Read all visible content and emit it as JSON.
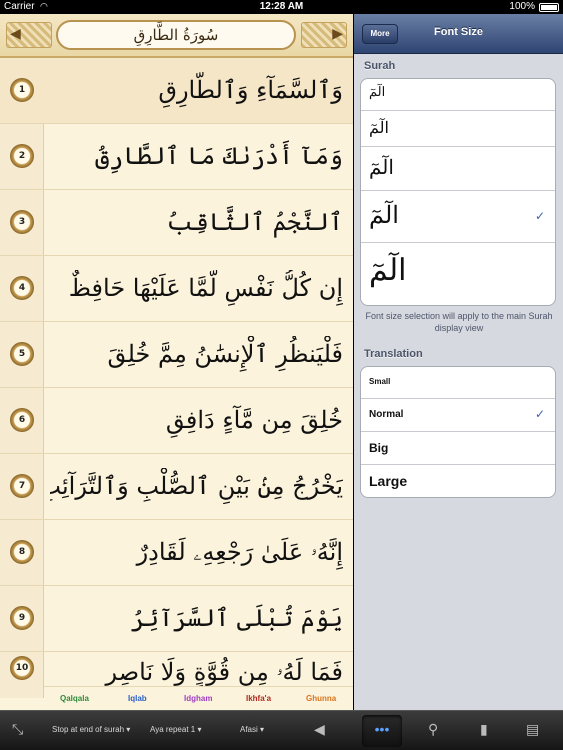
{
  "status_bar": {
    "carrier": "Carrier",
    "time": "12:28 AM",
    "battery": "100%"
  },
  "surah_header": {
    "title": "سُورَةُ الطَّارِقِ"
  },
  "ayat": [
    {
      "number": "1",
      "text": "وَٱلسَّمَآءِ وَٱلطَّارِقِ"
    },
    {
      "number": "2",
      "text": "وَمَآ أَدْرَىٰكَ مَا ٱلطَّارِقُ"
    },
    {
      "number": "3",
      "text": "ٱلنَّجْمُ ٱلثَّاقِبُ"
    },
    {
      "number": "4",
      "text": "إِن كُلُّ نَفْسٍ لَّمَّا عَلَيْهَا حَافِظٌ"
    },
    {
      "number": "5",
      "text": "فَلْيَنظُرِ ٱلْإِنسَٰنُ مِمَّ خُلِقَ"
    },
    {
      "number": "6",
      "text": "خُلِقَ مِن مَّآءٍ دَافِقٍ"
    },
    {
      "number": "7",
      "text": "يَخْرُجُ مِنۢ بَيْنِ ٱلصُّلْبِ وَٱلتَّرَآئِبِ"
    },
    {
      "number": "8",
      "text": "إِنَّهُۥ عَلَىٰ رَجْعِهِۦ لَقَادِرٌ"
    },
    {
      "number": "9",
      "text": "يَوْمَ تُبْلَى ٱلسَّرَآئِرُ"
    },
    {
      "number": "10",
      "text": "فَمَا لَهُۥ مِن قُوَّةٍ وَلَا نَاصِرٍ"
    }
  ],
  "legend": {
    "items": [
      {
        "label": "Qalqala",
        "color": "#2e8b3a"
      },
      {
        "label": "Iqlab",
        "color": "#2a5fc4"
      },
      {
        "label": "Idgham",
        "color": "#a03cc4"
      },
      {
        "label": "Ikhfa'a",
        "color": "#b0281e"
      },
      {
        "label": "Ghunna",
        "color": "#d9741c"
      }
    ]
  },
  "settings": {
    "more_label": "More",
    "title": "Font Size",
    "surah_section": "Surah",
    "surah_sizes": [
      {
        "glyph": "الٓمٓ",
        "selected": false
      },
      {
        "glyph": "الٓمٓ",
        "selected": false
      },
      {
        "glyph": "الٓمٓ",
        "selected": false
      },
      {
        "glyph": "الٓمٓ",
        "selected": true
      },
      {
        "glyph": "الٓمٓ",
        "selected": false
      }
    ],
    "note": "Font size selection will apply to the main Surah display view",
    "translation_section": "Translation",
    "translation_sizes": [
      {
        "label": "Small",
        "selected": false
      },
      {
        "label": "Normal",
        "selected": true
      },
      {
        "label": "Big",
        "selected": false
      },
      {
        "label": "Large",
        "selected": false
      }
    ],
    "check_mark": "✓"
  },
  "toolbar": {
    "stop_option": "Stop at end of surah",
    "repeat_option": "Aya repeat 1",
    "reciter": "Afasi",
    "chevron": "▾"
  }
}
